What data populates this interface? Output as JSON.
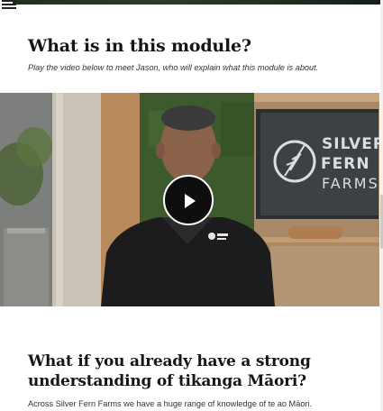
{
  "module_section": {
    "heading": "What is in this module?",
    "intro": "Play the video below to meet Jason, who will explain what this module is about."
  },
  "video": {
    "tv_brand": {
      "line1": "SILVER",
      "line2": "FERN",
      "line3": "FARMS"
    },
    "play_icon": "play-icon"
  },
  "knowledge_section": {
    "heading": "What if you already have a strong understanding of tikanga Māori?",
    "paragraph": "Across Silver Fern Farms we have a huge range of knowledge of te ao Māori."
  },
  "colors": {
    "heading": "#161616",
    "play_button": "#0e0e0e",
    "wall_green": "#3d5a2c",
    "shirt": "#1c1c1e"
  }
}
